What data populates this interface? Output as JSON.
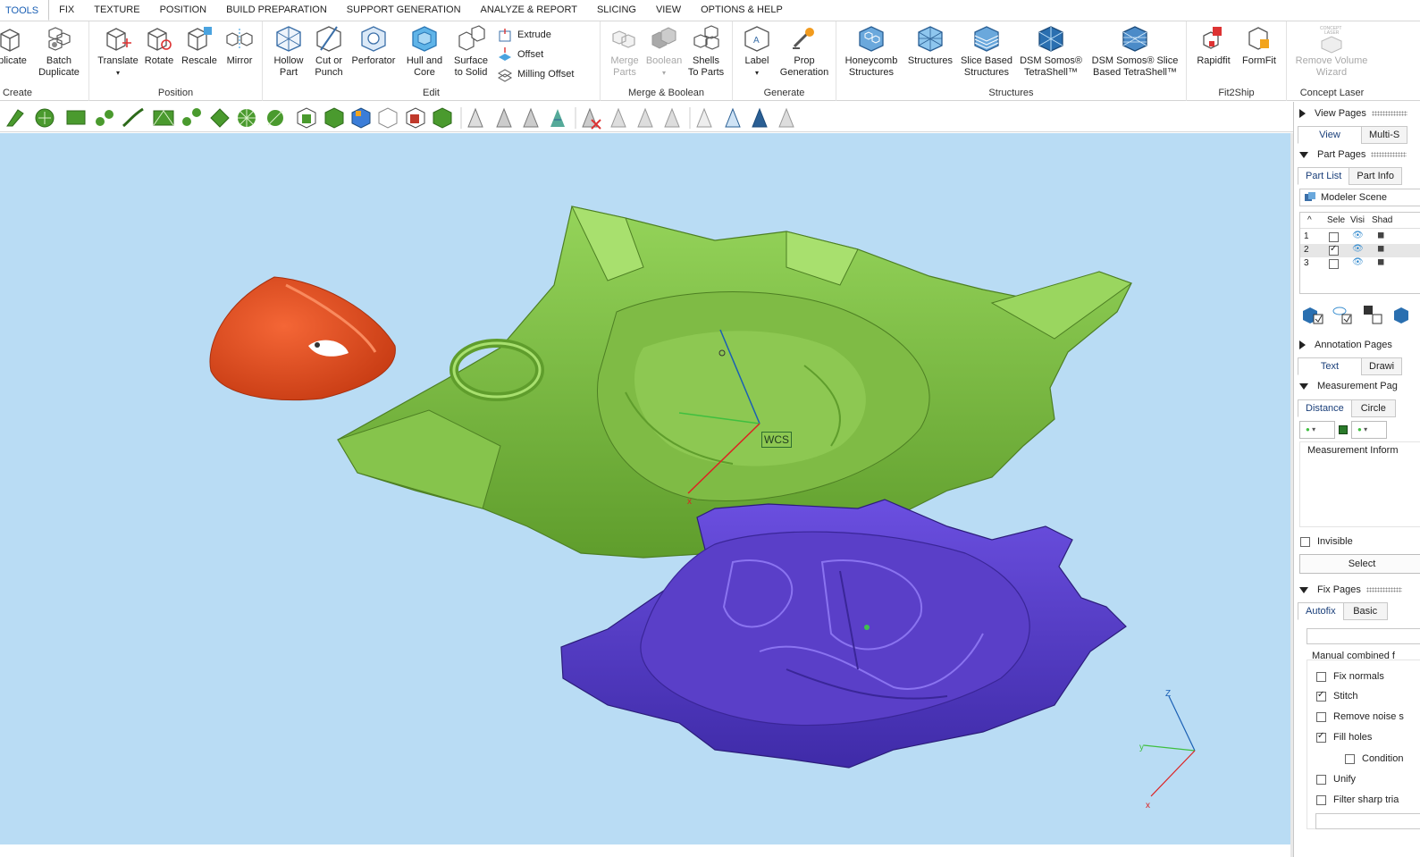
{
  "menu": {
    "tabs": [
      "TOOLS",
      "FIX",
      "TEXTURE",
      "POSITION",
      "BUILD PREPARATION",
      "SUPPORT GENERATION",
      "ANALYZE & REPORT",
      "SLICING",
      "VIEW",
      "OPTIONS & HELP"
    ],
    "active_tab": "TOOLS"
  },
  "ribbon": {
    "create": {
      "label": "Create",
      "duplicate": "plicate",
      "batch_duplicate": "Batch\nDuplicate"
    },
    "position": {
      "label": "Position",
      "translate": "Translate",
      "rotate": "Rotate",
      "rescale": "Rescale",
      "mirror": "Mirror"
    },
    "edit": {
      "label": "Edit",
      "hollow": "Hollow\nPart",
      "cut": "Cut or\nPunch",
      "perforator": "Perforator",
      "hull": "Hull and\nCore",
      "surface": "Surface\nto Solid",
      "extrude": "Extrude",
      "offset": "Offset",
      "milling": "Milling Offset"
    },
    "merge": {
      "label": "Merge & Boolean",
      "merge_parts": "Merge\nParts",
      "boolean": "Boolean",
      "shells": "Shells\nTo Parts"
    },
    "generate": {
      "label": "Generate",
      "label_btn": "Label",
      "prop": "Prop\nGeneration"
    },
    "structures": {
      "label": "Structures",
      "honeycomb": "Honeycomb\nStructures",
      "structures_btn": "Structures",
      "slice_based": "Slice Based\nStructures",
      "tetrashell": "DSM Somos®\nTetraShell™",
      "slice_tetrashell": "DSM Somos® Slice\nBased TetraShell™"
    },
    "fit2ship": {
      "label": "Fit2Ship",
      "rapidfit": "Rapidfit",
      "formfit": "FormFit"
    },
    "concept": {
      "label": "Concept Laser",
      "remove_volume": "Remove Volume\nWizard",
      "icon_text": "CONCEPT\nLASER"
    }
  },
  "viewport": {
    "wcs_label": "WCS",
    "axis_x": "x",
    "axis_y": "y",
    "axis_z": "Z",
    "background": "#b9dcf4"
  },
  "panel": {
    "view_pages": "View Pages",
    "view_tabs": [
      "View",
      "Multi-S"
    ],
    "part_pages": "Part Pages",
    "part_tabs": [
      "Part List",
      "Part Info"
    ],
    "modeler_scene": "Modeler Scene",
    "columns": [
      "Sele",
      "Visi",
      "Shad"
    ],
    "rows": [
      {
        "id": "1",
        "selected": false
      },
      {
        "id": "2",
        "selected": true
      },
      {
        "id": "3",
        "selected": false
      }
    ],
    "annotation_pages": "Annotation Pages",
    "annotation_tabs": [
      "Text",
      "Drawi"
    ],
    "measurement_pages": "Measurement Pag",
    "measurement_tabs": [
      "Distance",
      "Circle"
    ],
    "measurement_info": "Measurement Inform",
    "invisible": "Invisible",
    "select_btn": "Select",
    "fix_pages": "Fix Pages",
    "fix_tabs": [
      "Autofix",
      "Basic"
    ],
    "manual_combined": "Manual combined f",
    "fix_options": [
      {
        "label": "Fix normals",
        "checked": false
      },
      {
        "label": "Stitch",
        "checked": true
      },
      {
        "label": "Remove noise s",
        "checked": false
      },
      {
        "label": "Fill holes",
        "checked": true
      },
      {
        "label": "Condition",
        "checked": false
      },
      {
        "label": "Unify",
        "checked": false
      },
      {
        "label": "Filter sharp tria",
        "checked": false
      }
    ]
  },
  "colors": {
    "part_green": "#7bc043",
    "part_orange": "#e34b22",
    "part_purple": "#5a3fc8",
    "accent": "#1a5fb4"
  }
}
